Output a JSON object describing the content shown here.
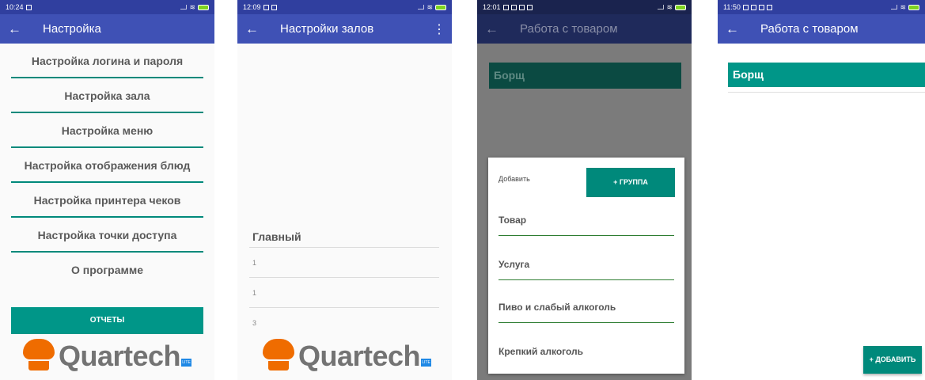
{
  "colors": {
    "primary": "#3f51b5",
    "primary_dark": "#303f9f",
    "accent": "#009688",
    "logo_orange": "#ef6c00"
  },
  "screen1": {
    "time": "10:24",
    "title": "Настройка",
    "menu": [
      "Настройка логина и пароля",
      "Настройка зала",
      "Настройка меню",
      "Настройка отображения блюд",
      "Настройка принтера чеков",
      "Настройка точки доступа",
      "О программе"
    ],
    "reports_button": "ОТЧЕТЫ",
    "logo_text": "Quartech",
    "logo_badge": "LITE"
  },
  "screen2": {
    "time": "12:09",
    "title": "Настройки залов",
    "hall_name": "Главный",
    "rows": [
      "1",
      "1",
      "3"
    ],
    "logo_text": "Quartech",
    "logo_badge": "LITE"
  },
  "screen3": {
    "time": "12:01",
    "title": "Работа с товаром",
    "item": "Борщ",
    "dialog": {
      "add_label": "Добавить",
      "group_button": "+ ГРУППА",
      "options": [
        "Товар",
        "Услуга",
        "Пиво и слабый алкоголь",
        "Крепкий алкоголь"
      ]
    }
  },
  "screen4": {
    "time": "11:50",
    "title": "Работа с товаром",
    "item": "Борщ",
    "add_button": "+ ДОБАВИТЬ"
  }
}
